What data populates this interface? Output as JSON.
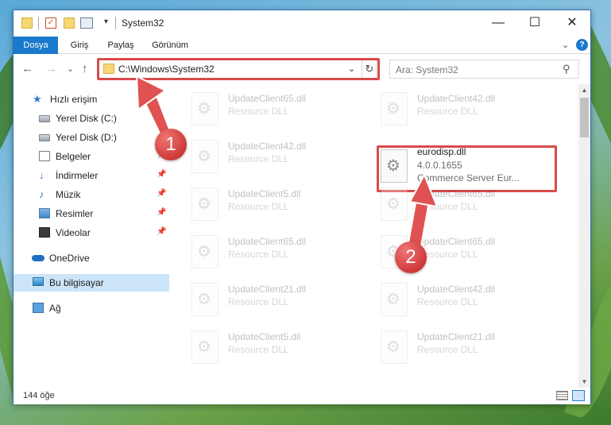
{
  "titlebar": {
    "title": "System32",
    "minimize": "—",
    "maximize": "☐",
    "close": "✕"
  },
  "ribbon": {
    "tabs": [
      "Dosya",
      "Giriş",
      "Paylaş",
      "Görünüm"
    ],
    "chevron": "⌄",
    "help": "?"
  },
  "nav": {
    "back": "←",
    "forward": "→",
    "recent": "⌄",
    "up": "↑",
    "address": "C:\\Windows\\System32",
    "address_drop": "⌄",
    "refresh": "↻",
    "search_placeholder": "Ara: System32",
    "search_icon": "⚲"
  },
  "sidebar": {
    "items": [
      {
        "label": "Hızlı erişim",
        "icon": "star-icon"
      },
      {
        "label": "Yerel Disk (C:)",
        "icon": "drive-icon"
      },
      {
        "label": "Yerel Disk (D:)",
        "icon": "drive-icon"
      },
      {
        "label": "Belgeler",
        "icon": "documents-icon",
        "pinned": true
      },
      {
        "label": "İndirmeler",
        "icon": "downloads-icon",
        "pinned": true
      },
      {
        "label": "Müzik",
        "icon": "music-icon",
        "pinned": true
      },
      {
        "label": "Resimler",
        "icon": "pictures-icon",
        "pinned": true
      },
      {
        "label": "Videolar",
        "icon": "videos-icon",
        "pinned": true
      },
      {
        "label": "OneDrive",
        "icon": "cloud-icon"
      },
      {
        "label": "Bu bilgisayar",
        "icon": "computer-icon",
        "selected": true
      },
      {
        "label": "Ağ",
        "icon": "network-icon"
      }
    ],
    "pin_glyph": "📌"
  },
  "files": {
    "left": [
      {
        "name": "UpdateClient65.dll",
        "type": "Resource DLL"
      },
      {
        "name": "UpdateClient42.dll",
        "type": "Resource DLL"
      },
      {
        "name": "UpdateClient5.dll",
        "type": "Resource DLL"
      },
      {
        "name": "UpdateClient65.dll",
        "type": "Resource DLL"
      },
      {
        "name": "UpdateClient21.dll",
        "type": "Resource DLL"
      },
      {
        "name": "UpdateClient5.dll",
        "type": "Resource DLL"
      }
    ],
    "right": [
      {
        "name": "UpdateClient42.dll",
        "type": "Resource DLL"
      },
      {
        "name": "eurodisp.dll",
        "type": "4.0.0.1655",
        "desc": "Commerce Server Eur...",
        "highlighted": true
      },
      {
        "name": "UpdateClient65.dll",
        "type": "Resource DLL"
      },
      {
        "name": "UpdateClient65.dll",
        "type": "Resource DLL"
      },
      {
        "name": "UpdateClient42.dll",
        "type": "Resource DLL"
      },
      {
        "name": "UpdateClient21.dll",
        "type": "Resource DLL"
      }
    ]
  },
  "status": {
    "count": "144 öğe"
  },
  "markers": [
    "1",
    "2"
  ],
  "colors": {
    "accent": "#1979ca",
    "highlight": "#d94a4a",
    "selected": "#cce4f7"
  }
}
